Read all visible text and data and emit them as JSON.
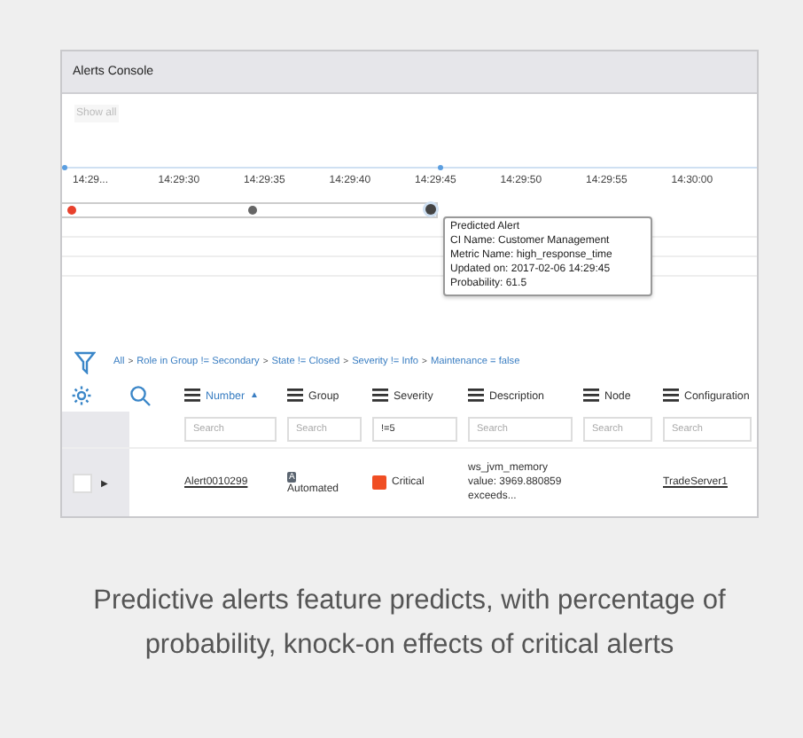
{
  "window": {
    "title": "Alerts Console"
  },
  "show_all": "Show all",
  "timeline": {
    "ticks": [
      "14:29...",
      "14:29:30",
      "14:29:35",
      "14:29:40",
      "14:29:45",
      "14:29:50",
      "14:29:55",
      "14:30:00"
    ],
    "events": [
      {
        "kind": "alert",
        "color": "#e8412c"
      },
      {
        "kind": "alert",
        "color": "#666666"
      },
      {
        "kind": "predicted",
        "color": "#444444",
        "selected": true
      }
    ]
  },
  "tooltip": {
    "title": "Predicted Alert",
    "lines": [
      "CI Name: Customer Management",
      "Metric Name: high_response_time",
      "Updated on: 2017-02-06 14:29:45",
      "Probability: 61.5"
    ]
  },
  "filter": {
    "separator": ">",
    "items": [
      "All",
      "Role in Group != Secondary",
      "State != Closed",
      "Severity != Info",
      "Maintenance = false"
    ]
  },
  "table": {
    "columns": [
      {
        "label": "Number",
        "sorted": true,
        "sort_glyph": "▲",
        "search": {
          "placeholder": "Search"
        }
      },
      {
        "label": "Group",
        "sorted": false,
        "search": {
          "placeholder": "Search"
        }
      },
      {
        "label": "Severity",
        "sorted": false,
        "search": {
          "value": "!=5"
        }
      },
      {
        "label": "Description",
        "sorted": false,
        "search": {
          "placeholder": "Search"
        }
      },
      {
        "label": "Node",
        "sorted": false,
        "search": {
          "placeholder": "Search"
        }
      },
      {
        "label": "Configuration",
        "sorted": false,
        "search": {
          "placeholder": "Search"
        }
      }
    ],
    "rows": [
      {
        "checked": false,
        "expand_glyph": "▶",
        "number": "Alert0010299",
        "group_badge": "A",
        "group": "Automated",
        "severity": "Critical",
        "color": "#f04e23",
        "description": "ws_jvm_memory value: 3969.880859 exceeds...",
        "configuration": "TradeServer1"
      }
    ]
  },
  "caption": "Predictive alerts feature predicts, with percentage of probability, knock-on effects of critical alerts"
}
